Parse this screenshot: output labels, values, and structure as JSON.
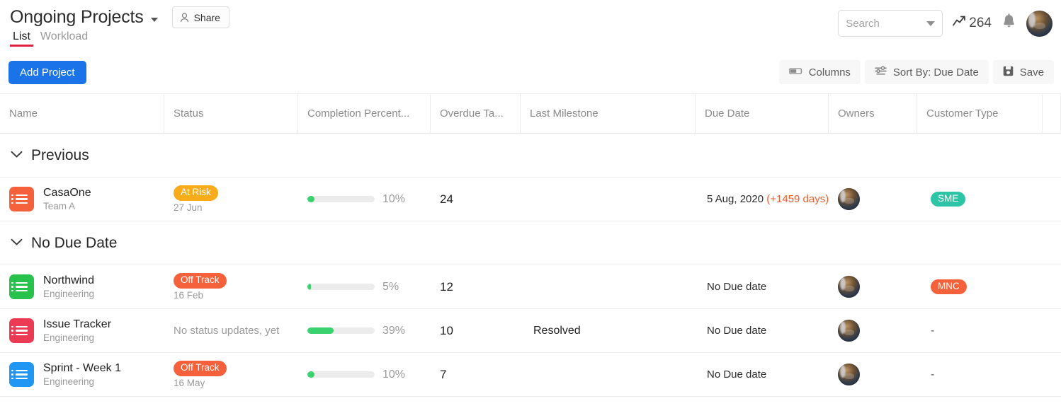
{
  "header": {
    "title": "Ongoing Projects",
    "dropdown_icon": "chevron-down-icon",
    "share_label": "Share",
    "share_icon": "person-icon",
    "tabs": [
      {
        "label": "List",
        "active": true
      },
      {
        "label": "Workload",
        "active": false
      }
    ],
    "search": {
      "placeholder": "Search",
      "value": ""
    },
    "stat_icon": "trend-up-icon",
    "stat_value": "264",
    "bell_icon": "bell-icon",
    "avatar_icon": "user-avatar"
  },
  "toolbar": {
    "add_project_label": "Add Project",
    "buttons": [
      {
        "label": "Columns",
        "icon": "columns-icon"
      },
      {
        "label": "Sort By: Due Date",
        "icon": "sliders-icon"
      },
      {
        "label": "Save",
        "icon": "floppy-disk-icon"
      }
    ]
  },
  "table": {
    "columns": [
      {
        "label": "Name",
        "key": "col-name"
      },
      {
        "label": "Status",
        "key": "col-status"
      },
      {
        "label": "Completion Percent...",
        "key": "col-pct"
      },
      {
        "label": "Overdue Ta...",
        "key": "col-overdue"
      },
      {
        "label": "Last Milestone",
        "key": "col-mile"
      },
      {
        "label": "Due Date",
        "key": "col-due"
      },
      {
        "label": "Owners",
        "key": "col-owners"
      },
      {
        "label": "Customer Type",
        "key": "col-cust"
      }
    ],
    "groups": [
      {
        "title": "Previous",
        "collapse_icon": "chevron-down-icon",
        "rows": [
          {
            "icon_color": "#f4613a",
            "name": "CasaOne",
            "team": "Team A",
            "status_label": "At Risk",
            "status_color": "#f9ac19",
            "status_date": "27 Jun",
            "status_none": "",
            "percent": "10%",
            "percent_value": 10,
            "overdue": "24",
            "milestone": "",
            "due_date": "5 Aug, 2020",
            "due_overdue": "(+1459 days)",
            "owner_icon": "user-avatar",
            "customer_type": "SME",
            "customer_color": "#2ec4a6"
          }
        ]
      },
      {
        "title": "No Due Date",
        "collapse_icon": "chevron-down-icon",
        "rows": [
          {
            "icon_color": "#27c24c",
            "name": "Northwind",
            "team": "Engineering",
            "status_label": "Off Track",
            "status_color": "#f4613a",
            "status_date": "16 Feb",
            "status_none": "",
            "percent": "5%",
            "percent_value": 5,
            "overdue": "12",
            "milestone": "",
            "due_date": "No Due date",
            "due_overdue": "",
            "owner_icon": "user-avatar",
            "customer_type": "MNC",
            "customer_color": "#f4613a"
          },
          {
            "icon_color": "#ec3a55",
            "name": "Issue Tracker",
            "team": "Engineering",
            "status_label": "",
            "status_color": "",
            "status_date": "",
            "status_none": "No status updates, yet",
            "percent": "39%",
            "percent_value": 39,
            "overdue": "10",
            "milestone": "Resolved",
            "due_date": "No Due date",
            "due_overdue": "",
            "owner_icon": "user-avatar",
            "customer_type": "-",
            "customer_color": ""
          },
          {
            "icon_color": "#2196f3",
            "name": "Sprint - Week 1",
            "team": "Engineering",
            "status_label": "Off Track",
            "status_color": "#f4613a",
            "status_date": "16 May",
            "status_none": "",
            "percent": "10%",
            "percent_value": 10,
            "overdue": "7",
            "milestone": "",
            "due_date": "No Due date",
            "due_overdue": "",
            "owner_icon": "user-avatar",
            "customer_type": "-",
            "customer_color": ""
          }
        ]
      }
    ]
  }
}
